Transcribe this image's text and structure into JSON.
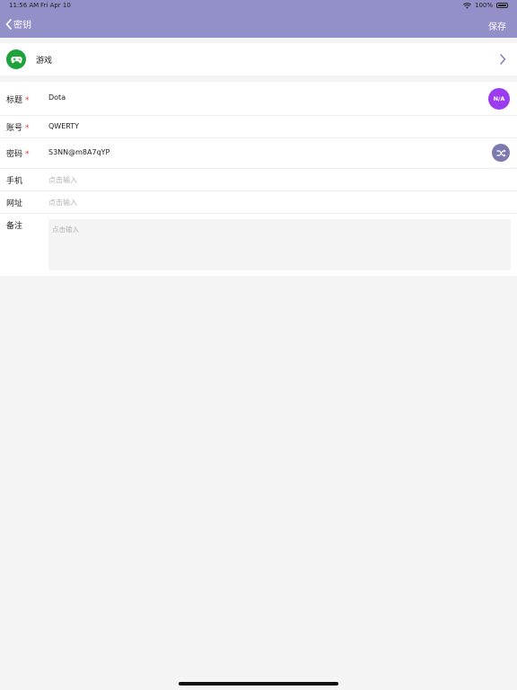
{
  "status_bar": {
    "time": "11:56 AM",
    "date": "Fri Apr 10",
    "battery": "100%"
  },
  "nav": {
    "back_label": "密钥",
    "save_label": "保存"
  },
  "category": {
    "label": "游戏",
    "icon": "gamepad-icon"
  },
  "fields": {
    "title": {
      "label": "标题",
      "required_mark": "*",
      "value": "Dota",
      "badge": "N/A"
    },
    "account": {
      "label": "账号",
      "required_mark": "*",
      "value": "QWERTY"
    },
    "password": {
      "label": "密码",
      "required_mark": "*",
      "value": "S3NN@m8A7qYP",
      "action_icon": "shuffle-icon"
    },
    "phone": {
      "label": "手机",
      "placeholder": "点击输入"
    },
    "url": {
      "label": "网址",
      "placeholder": "点击输入"
    },
    "notes": {
      "label": "备注",
      "placeholder": "点击输入"
    }
  },
  "colors": {
    "nav_bar": "#938fc8",
    "category_icon_bg": "#1ea33a",
    "badge_bg": "#9b3cf0",
    "shuffle_bg": "#7d7ab0",
    "required": "#e03a2e"
  }
}
